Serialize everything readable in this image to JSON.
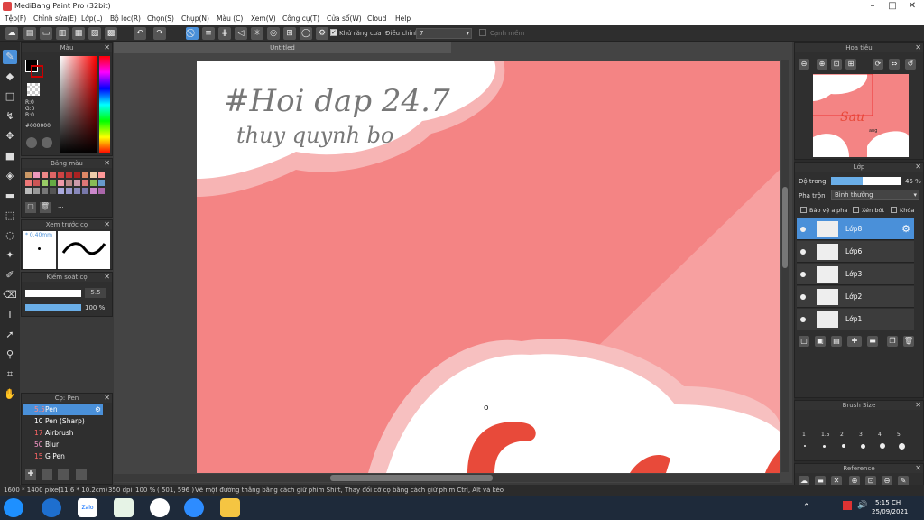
{
  "window": {
    "title": "MediBang Paint Pro (32bit)"
  },
  "menu": [
    "Tệp(F)",
    "Chỉnh sửa(E)",
    "Lớp(L)",
    "Bộ lọc(R)",
    "Chọn(S)",
    "Chụp(N)",
    "Màu (C)",
    "Xem(V)",
    "Công cụ(T)",
    "Cửa sổ(W)",
    "Cloud",
    "Help"
  ],
  "toolbar": {
    "antialias_label": "Khử răng cưa",
    "adjust_label": "Điều chỉnh",
    "adjust_value": "7",
    "edge_label": "Cạnh mềm"
  },
  "color_panel": {
    "title": "Màu",
    "r": "R:0",
    "g": "G:0",
    "b": "B:0",
    "hex": "#000000",
    "primary": "#000000",
    "secondary": "#cc0000"
  },
  "palette": {
    "title": "Bảng màu",
    "more": "···"
  },
  "brush_preview": {
    "title": "Xem trước cọ",
    "size": "* 0.40mm"
  },
  "brush_control": {
    "title": "Kiểm soát cọ",
    "size": "5.5",
    "opacity": "100 %"
  },
  "brush_list": {
    "title": "Cọ: Pen",
    "items": [
      {
        "size": "5.5",
        "name": "Pen"
      },
      {
        "size": "10",
        "name": "Pen (Sharp)"
      },
      {
        "size": "17",
        "name": "Airbrush"
      },
      {
        "size": "50",
        "name": "Blur"
      },
      {
        "size": "15",
        "name": "G Pen"
      }
    ]
  },
  "document": {
    "tab": "Untitled",
    "handwriting_line1": "#Hoi dap 24.7",
    "handwriting_line2": "thuy quynh bo",
    "cursor": "o"
  },
  "navigator": {
    "title": "Hoa tiêu",
    "logo_text": "Sau",
    "logo_sub": "ang"
  },
  "layers": {
    "title": "Lớp",
    "opacity_label": "Độ trong",
    "opacity_value": "45 %",
    "opacity_fraction": 0.45,
    "blend_label": "Pha trộn",
    "blend_value": "Bình thường",
    "protect_alpha": "Bảo vệ alpha",
    "clipping": "Xén bớt",
    "lock": "Khóa",
    "items": [
      "Lớp8",
      "Lớp6",
      "Lớp3",
      "Lớp2",
      "Lớp1"
    ]
  },
  "brush_size": {
    "title": "Brush Size",
    "sizes": [
      "1",
      "1.5",
      "2",
      "3",
      "4",
      "5"
    ]
  },
  "reference": {
    "title": "Reference"
  },
  "status": {
    "dimensions": "1600 * 1400 pixel",
    "cm": "(11.6 * 10.2cm)",
    "dpi": "350 dpi",
    "zoom": "100 %",
    "coords": "( 501, 596 )",
    "hint": "Vẽ một đường thẳng bằng cách giữ phím Shift, Thay đổi cỡ cọ bằng cách giữ phím Ctrl, Alt và kéo"
  },
  "taskbar": {
    "time": "5:15 CH",
    "date": "25/09/2021",
    "zalo": "Zalo"
  }
}
